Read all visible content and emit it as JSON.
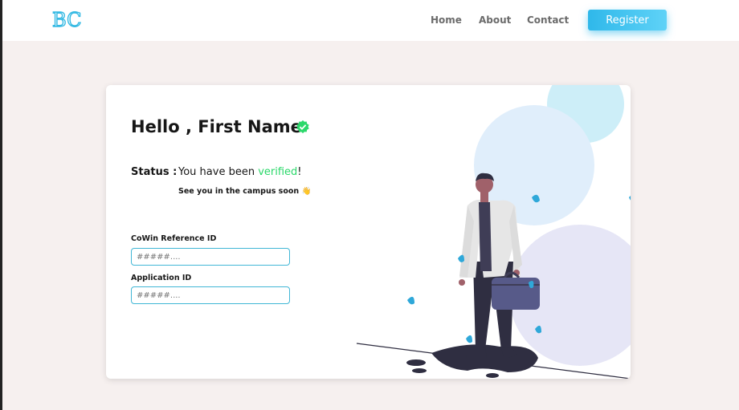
{
  "header": {
    "logo_text": "BC",
    "nav": [
      {
        "label": "Home"
      },
      {
        "label": "About"
      },
      {
        "label": "Contact"
      }
    ],
    "register_label": "Register"
  },
  "card": {
    "greeting": "Hello , First Name",
    "status_label": "Status :",
    "status_prefix": "You have been ",
    "status_value": "verified",
    "status_suffix": "!",
    "campus_note": "See you in the campus soon 👋",
    "fields": [
      {
        "label": "CoWin Reference ID",
        "placeholder": "#####...."
      },
      {
        "label": "Application ID",
        "placeholder": "#####...."
      }
    ]
  },
  "colors": {
    "accent": "#2fb8ea",
    "verified": "#2bd86a",
    "background": "#f6f0ef"
  }
}
